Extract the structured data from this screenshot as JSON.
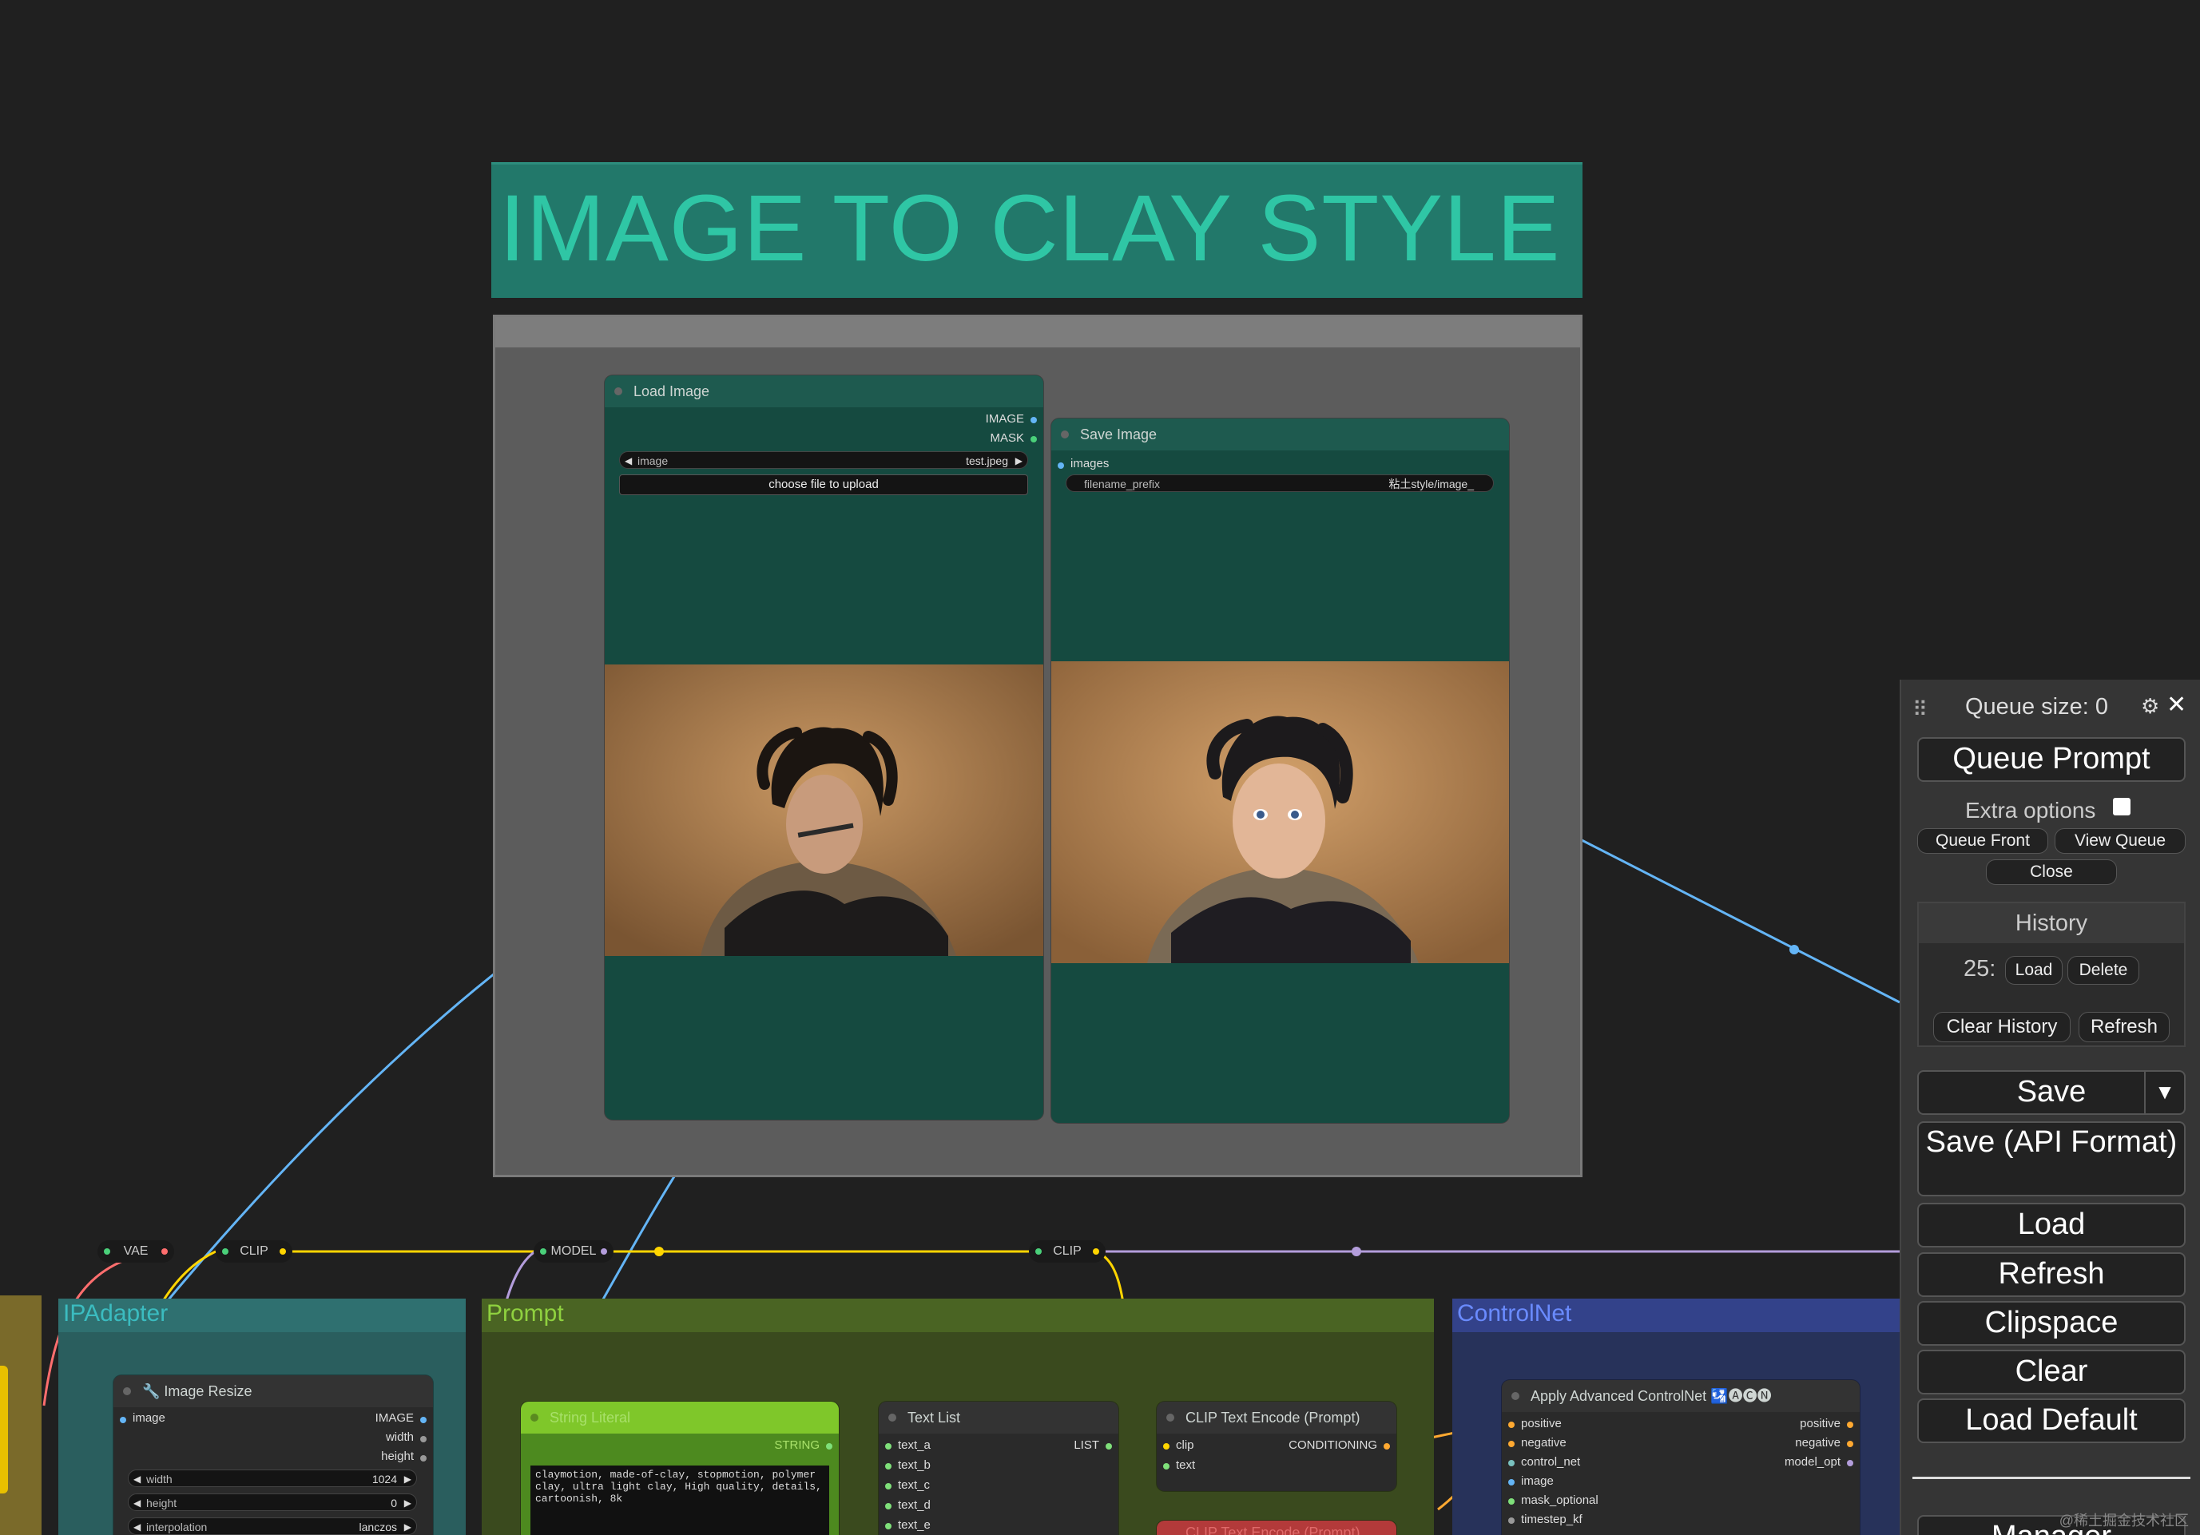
{
  "title_note": "IMAGE TO CLAY STYLE",
  "load_image": {
    "title": "Load Image",
    "outputs": [
      "IMAGE",
      "MASK"
    ],
    "image_widget_label": "image",
    "image_widget_value": "test.jpeg",
    "upload_button": "choose file to upload"
  },
  "save_image": {
    "title": "Save Image",
    "input": "images",
    "prefix_label": "filename_prefix",
    "prefix_value": "粘土style/image_"
  },
  "reroutes": {
    "vae": "VAE",
    "clip1": "CLIP",
    "model": "MODEL",
    "clip2": "CLIP"
  },
  "groups": {
    "ipadapter": "IPAdapter",
    "prompt": "Prompt",
    "controlnet": "ControlNet"
  },
  "image_resize": {
    "title": "🔧 Image Resize",
    "input": "image",
    "outputs": [
      "IMAGE",
      "width",
      "height"
    ],
    "width_label": "width",
    "width_value": "1024",
    "height_label": "height",
    "height_value": "0",
    "interp_label": "interpolation",
    "interp_value": "lanczos"
  },
  "string_literal": {
    "title": "String Literal",
    "output": "STRING",
    "text": "claymotion, made-of-clay, stopmotion, polymer clay, ultra light clay, High quality, details, cartoonish, 8k"
  },
  "text_list": {
    "title": "Text List",
    "inputs": [
      "text_a",
      "text_b",
      "text_c",
      "text_d",
      "text_e"
    ],
    "output": "LIST"
  },
  "clip_encode": {
    "title": "CLIP Text Encode (Prompt)",
    "inputs": [
      "clip",
      "text"
    ],
    "output": "CONDITIONING",
    "second_title": "CLIP Text Encode (Prompt)"
  },
  "controlnet_node": {
    "title": "Apply Advanced ControlNet",
    "badge": "🛂🅐🅒🅝",
    "inputs": [
      "positive",
      "negative",
      "control_net",
      "image",
      "mask_optional",
      "timestep_kf"
    ],
    "outputs": [
      "positive",
      "negative",
      "model_opt"
    ]
  },
  "panel": {
    "queue_size": "Queue size: 0",
    "queue_prompt": "Queue Prompt",
    "extra_options": "Extra options",
    "queue_front": "Queue Front",
    "view_queue": "View Queue",
    "close": "Close",
    "history": "History",
    "history_item": "25:",
    "load_small": "Load",
    "delete": "Delete",
    "clear_history": "Clear History",
    "refresh_small": "Refresh",
    "save": "Save",
    "save_api": "Save (API Format)",
    "load": "Load",
    "refresh": "Refresh",
    "clipspace": "Clipspace",
    "clear": "Clear",
    "load_default": "Load Default",
    "manager": "Manager"
  },
  "watermark": "@稀土掘金技术社区",
  "colors": {
    "background": "#202020",
    "title_bg": "#22786a",
    "title_text": "#2fc6a5",
    "node_body": "#154a40",
    "image_wire": "#64b5f6",
    "clip_wire": "#ffd500",
    "vae_wire": "#ff6e6e",
    "model_wire": "#b39ddb",
    "conditioning_wire": "#ffa931"
  }
}
